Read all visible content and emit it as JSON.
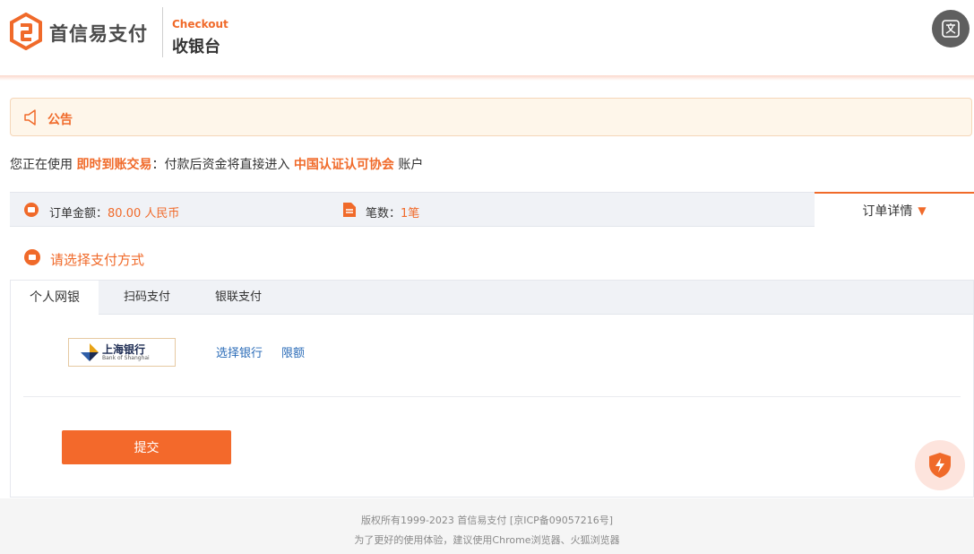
{
  "header": {
    "brand_name": "首信易支付",
    "checkout_en": "Checkout",
    "checkout_cn": "收银台",
    "brand_color": "#f06a2a",
    "translate_icon": "translate-icon"
  },
  "notice": {
    "icon": "speaker-icon",
    "title": "公告"
  },
  "using_line": {
    "prefix": "您正在使用",
    "mode": "即时到账交易",
    "middle": "：付款后资金将直接进入",
    "merchant": "中国认证认可协会",
    "suffix": "账户"
  },
  "summary": {
    "amount_label": "订单金额：",
    "amount_value": "80.00 人民币",
    "count_label": "笔数：",
    "count_value": "1笔",
    "detail_label": "订单详情"
  },
  "payment": {
    "section_title": "请选择支付方式",
    "tabs": [
      {
        "label": "个人网银",
        "active": true
      },
      {
        "label": "扫码支付",
        "active": false
      },
      {
        "label": "银联支付",
        "active": false
      }
    ],
    "bank": {
      "name_cn": "上海银行",
      "name_en": "Bank of Shanghai"
    },
    "choose_bank_label": "选择银行",
    "limit_label": "限额",
    "submit_label": "提交"
  },
  "footer": {
    "copyright": "版权所有1999-2023 首信易支付 [京ICP备09057216号]",
    "browser_tip": "为了更好的使用体验，建议使用Chrome浏览器、火狐浏览器"
  }
}
